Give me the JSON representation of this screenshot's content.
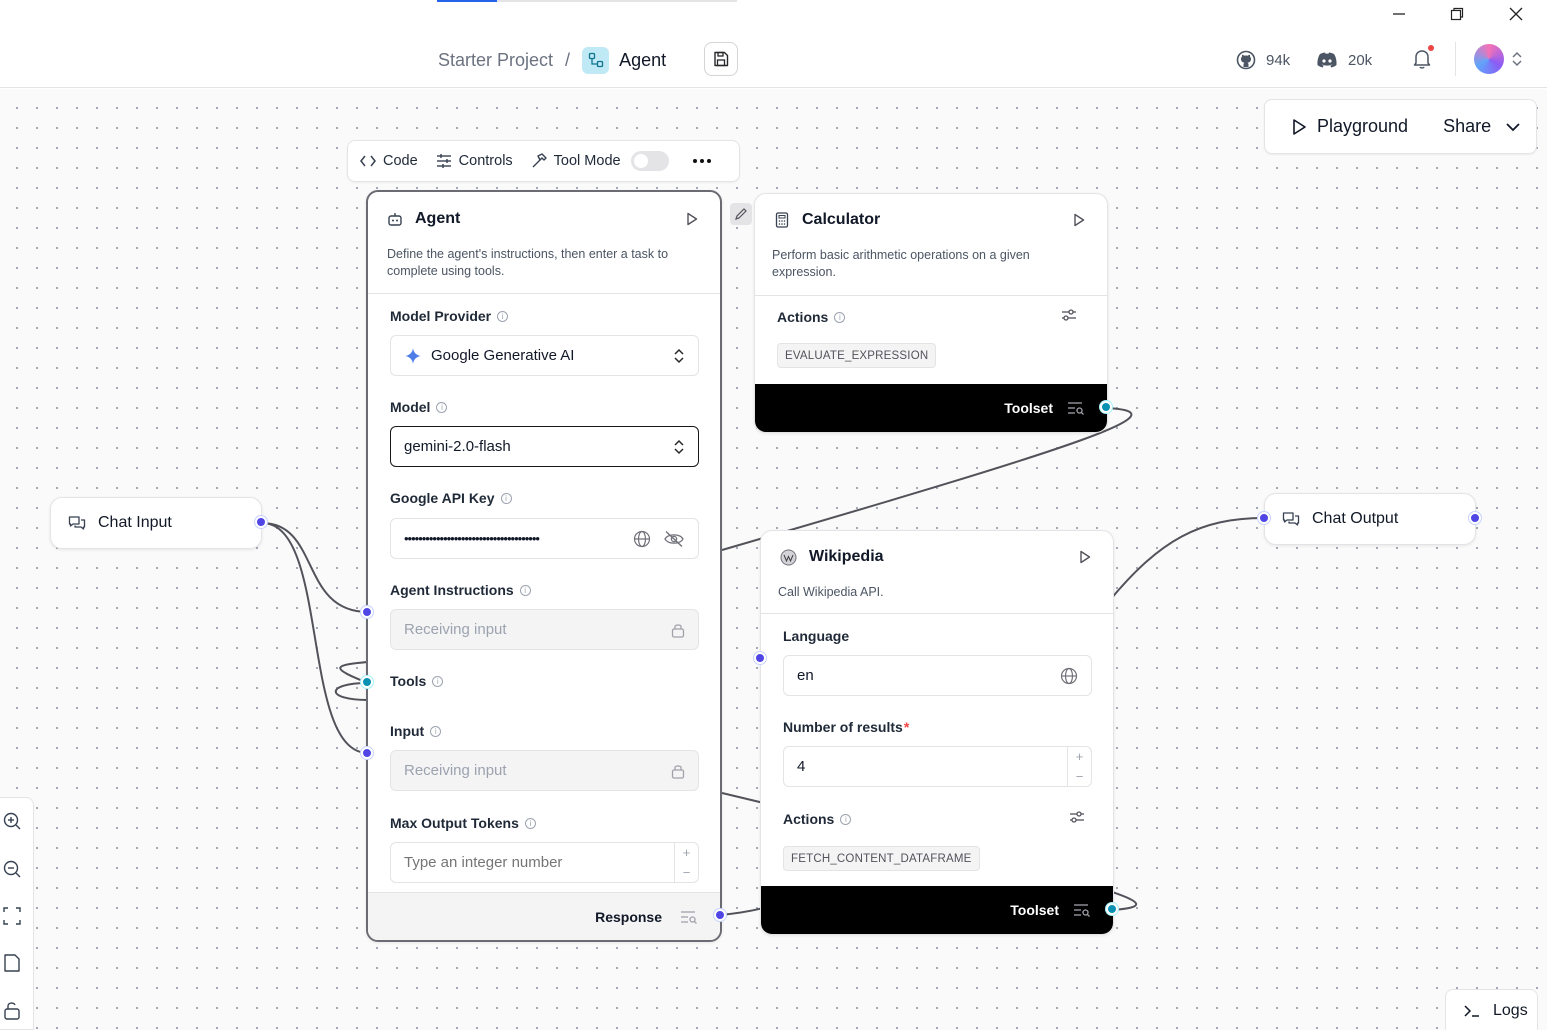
{
  "header": {
    "project": "Starter Project",
    "separator": "/",
    "flow_name": "Agent",
    "github_count": "94k",
    "discord_count": "20k"
  },
  "canvas_actions": {
    "playground": "Playground",
    "share": "Share"
  },
  "toolbar": {
    "code": "Code",
    "controls": "Controls",
    "tool_mode": "Tool Mode",
    "tool_mode_enabled": false
  },
  "agent": {
    "title": "Agent",
    "description": "Define the agent's instructions, then enter a task to complete using tools.",
    "fields": {
      "model_provider": {
        "label": "Model Provider",
        "value": "Google Generative AI"
      },
      "model": {
        "label": "Model",
        "value": "gemini-2.0-flash"
      },
      "api_key": {
        "label": "Google API Key",
        "value": "••••••••••••••••••••••••••••••••••••••"
      },
      "instructions": {
        "label": "Agent Instructions",
        "value": "Receiving input"
      },
      "tools": {
        "label": "Tools"
      },
      "input": {
        "label": "Input",
        "value": "Receiving input"
      },
      "max_tokens": {
        "label": "Max Output Tokens",
        "placeholder": "Type an integer number"
      }
    },
    "output": "Response"
  },
  "calculator": {
    "title": "Calculator",
    "description": "Perform basic arithmetic operations on a given expression.",
    "actions_label": "Actions",
    "action": "EVALUATE_EXPRESSION",
    "output": "Toolset"
  },
  "wikipedia": {
    "title": "Wikipedia",
    "description": "Call Wikipedia API.",
    "language_label": "Language",
    "language": "en",
    "results_label": "Number of results",
    "results_required": "*",
    "results": "4",
    "actions_label": "Actions",
    "action": "FETCH_CONTENT_DATAFRAME",
    "output": "Toolset"
  },
  "chat_input": {
    "title": "Chat Input"
  },
  "chat_output": {
    "title": "Chat Output"
  },
  "logs": "Logs",
  "colors": {
    "handle_data": "#4f46e5",
    "handle_tool": "#0891b2",
    "toolset_footer": "#000000"
  }
}
